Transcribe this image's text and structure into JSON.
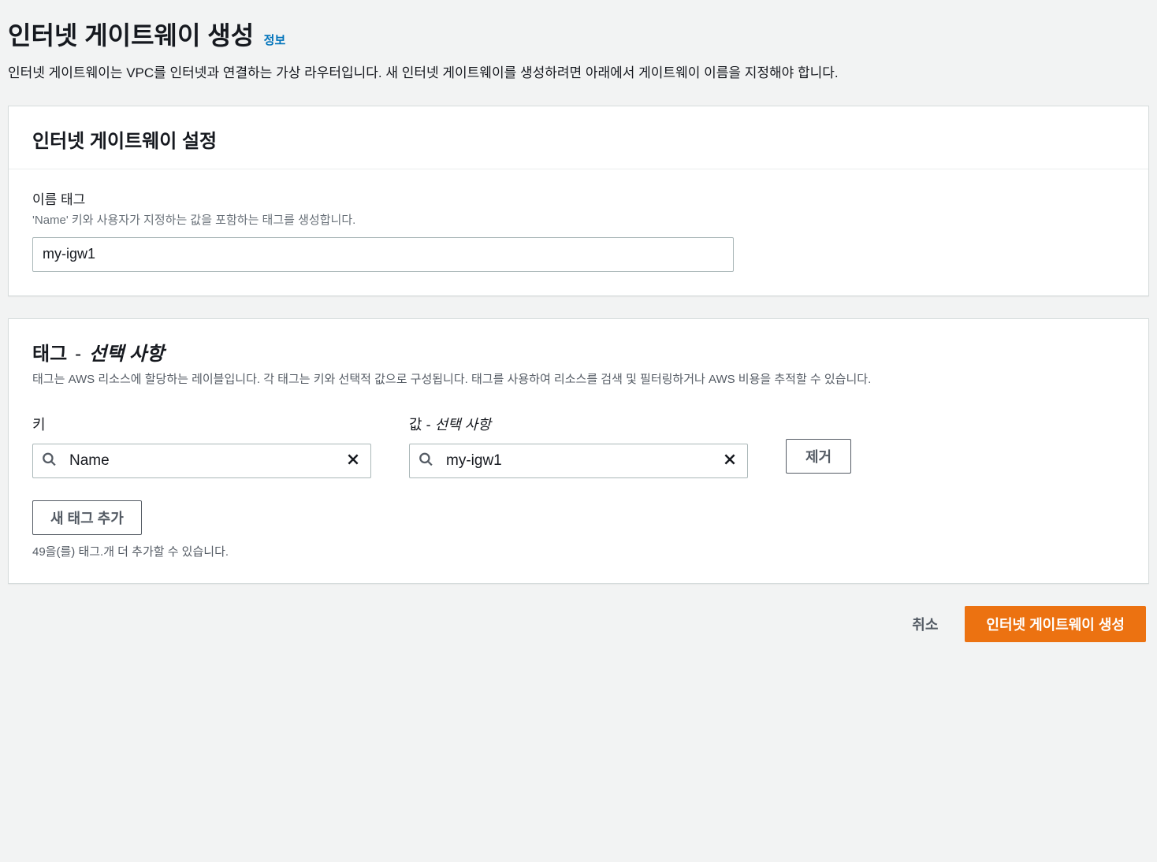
{
  "header": {
    "title": "인터넷 게이트웨이 생성",
    "info_link": "정보",
    "description": "인터넷 게이트웨이는 VPC를 인터넷과 연결하는 가상 라우터입니다. 새 인터넷 게이트웨이를 생성하려면 아래에서 게이트웨이 이름을 지정해야 합니다."
  },
  "settings_panel": {
    "title": "인터넷 게이트웨이 설정",
    "name_label": "이름 태그",
    "name_hint": "'Name' 키와 사용자가 지정하는 값을 포함하는 태그를 생성합니다.",
    "name_value": "my-igw1"
  },
  "tags_panel": {
    "title_prefix": "태그",
    "title_dash": " - ",
    "title_optional": "선택 사항",
    "description": "태그는 AWS 리소스에 할당하는 레이블입니다. 각 태그는 키와 선택적 값으로 구성됩니다. 태그를 사용하여 리소스를 검색 및 필터링하거나 AWS 비용을 추적할 수 있습니다.",
    "key_header": "키",
    "value_header_prefix": "값",
    "value_header_dash": " - ",
    "value_header_optional": "선택 사항",
    "rows": [
      {
        "key": "Name",
        "value": "my-igw1"
      }
    ],
    "remove_label": "제거",
    "add_label": "새 태그 추가",
    "remaining_text": "49을(를) 태그.개 더 추가할 수 있습니다."
  },
  "footer": {
    "cancel": "취소",
    "submit": "인터넷 게이트웨이 생성"
  }
}
